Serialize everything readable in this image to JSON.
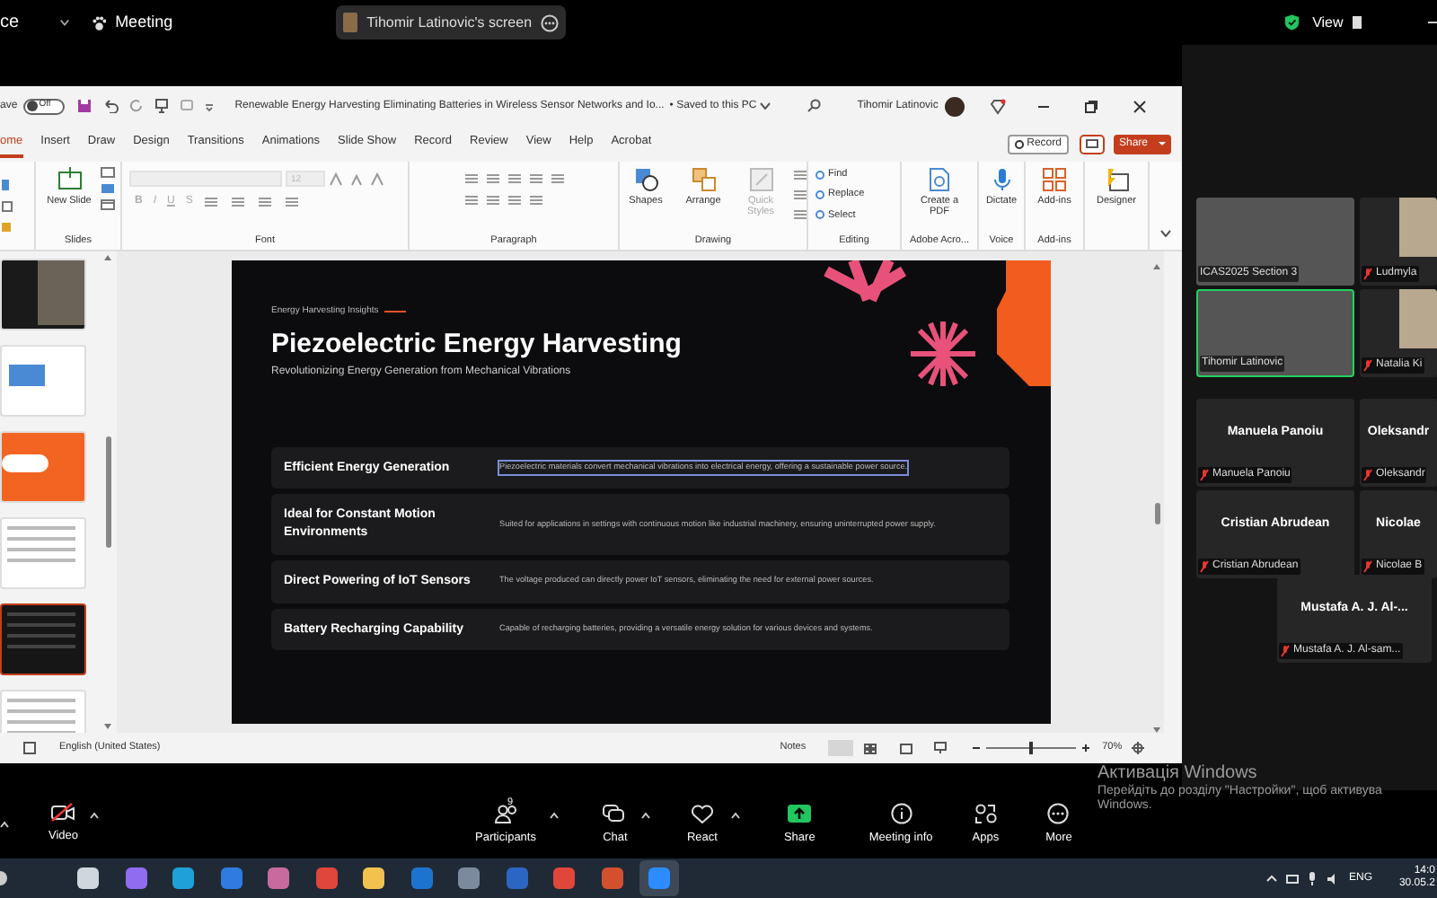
{
  "meeting_bar": {
    "app_name": "ce",
    "menu": "Meeting",
    "shared_screen": "Tihomir Latinovic's screen",
    "view": "View"
  },
  "powerpoint": {
    "autosave": {
      "label": "ave",
      "state": "Off",
      "on": false
    },
    "document_title": "Renewable Energy Harvesting Eliminating Batteries in Wireless Sensor Networks and Io...",
    "save_status": "• Saved to this PC",
    "user": "Tihomir Latinovic",
    "tabs": [
      {
        "label": "ome",
        "selected": true
      },
      {
        "label": "Insert",
        "selected": false
      },
      {
        "label": "Draw",
        "selected": false
      },
      {
        "label": "Design",
        "selected": false
      },
      {
        "label": "Transitions",
        "selected": false
      },
      {
        "label": "Animations",
        "selected": false
      },
      {
        "label": "Slide Show",
        "selected": false
      },
      {
        "label": "Record",
        "selected": false
      },
      {
        "label": "Review",
        "selected": false
      },
      {
        "label": "View",
        "selected": false
      },
      {
        "label": "Help",
        "selected": false
      },
      {
        "label": "Acrobat",
        "selected": false
      }
    ],
    "record_button": "Record",
    "share_button": "Share",
    "ribbon": {
      "font_size": "12",
      "font_styles": [
        "B",
        "I",
        "U",
        "S"
      ],
      "groups": [
        {
          "kind": "slides",
          "label": "Slides",
          "buttons": [
            {
              "label": "New Slide",
              "disabled": false
            }
          ]
        },
        {
          "kind": "font",
          "label": "Font"
        },
        {
          "kind": "paragraph",
          "label": "Paragraph"
        },
        {
          "kind": "drawing",
          "label": "Drawing",
          "buttons": [
            {
              "label": "Shapes",
              "disabled": false
            },
            {
              "label": "Arrange",
              "disabled": false
            },
            {
              "label": "Quick Styles",
              "disabled": true
            }
          ]
        },
        {
          "kind": "editing",
          "label": "Editing",
          "buttons": [
            {
              "label": "Find",
              "disabled": false
            },
            {
              "label": "Replace",
              "disabled": false
            },
            {
              "label": "Select",
              "disabled": false
            }
          ]
        },
        {
          "kind": "acrobat",
          "label": "Adobe Acro...",
          "buttons": [
            {
              "label": "Create a PDF",
              "disabled": false
            }
          ]
        },
        {
          "kind": "voice",
          "label": "Voice",
          "buttons": [
            {
              "label": "Dictate",
              "disabled": false
            }
          ]
        },
        {
          "kind": "addins",
          "label": "Add-ins",
          "buttons": [
            {
              "label": "Add-ins",
              "disabled": false
            }
          ]
        },
        {
          "kind": "designer",
          "buttons": [
            {
              "label": "Designer",
              "disabled": false
            }
          ]
        }
      ]
    },
    "thumbnails": [
      {
        "kind": "photo",
        "selected": false
      },
      {
        "kind": "diagram",
        "selected": false
      },
      {
        "kind": "orange",
        "selected": false
      },
      {
        "kind": "text",
        "selected": false
      },
      {
        "kind": "dark",
        "selected": true
      },
      {
        "kind": "text",
        "selected": false
      }
    ],
    "slide": {
      "eyebrow": "Energy Harvesting Insights",
      "title": "Piezoelectric Energy Harvesting",
      "subtitle": "Revolutionizing Energy Generation from Mechanical Vibrations",
      "rows": [
        {
          "heading": "Efficient Energy Generation",
          "text": "Piezoelectric materials convert mechanical vibrations into electrical energy, offering a sustainable power source.",
          "selected": true
        },
        {
          "heading": "Ideal for Constant Motion Environments",
          "text": "Suited for applications in settings with continuous motion like industrial machinery, ensuring uninterrupted power supply.",
          "selected": false
        },
        {
          "heading": "Direct Powering of IoT Sensors",
          "text": "The voltage produced can directly power IoT sensors, eliminating the need for external power sources.",
          "selected": false
        },
        {
          "heading": "Battery Recharging Capability",
          "text": "Capable of recharging batteries, providing a versatile energy solution for various devices and systems.",
          "selected": false
        }
      ]
    },
    "status_bar": {
      "language": "English (United States)",
      "notes": "Notes",
      "zoom": "70%",
      "zoom_slider": {
        "level": 0.5
      }
    }
  },
  "gallery": [
    {
      "kind": "video",
      "label": "ICAS2025 Section 3",
      "muted": false,
      "speaking": false
    },
    {
      "kind": "video",
      "label": "Ludmyla",
      "muted": true,
      "speaking": false
    },
    {
      "kind": "video",
      "label": "Tihomir Latinovic",
      "muted": false,
      "speaking": true
    },
    {
      "kind": "video",
      "label": "Natalia Ki",
      "muted": true,
      "speaking": false
    },
    {
      "kind": "name",
      "name": "Manuela Panoiu",
      "label": "Manuela Panoiu",
      "muted": true,
      "speaking": false
    },
    {
      "kind": "name",
      "name": "Oleksandr",
      "label": "Oleksandr",
      "muted": true,
      "speaking": false
    },
    {
      "kind": "name",
      "name": "Cristian Abrudean",
      "label": "Cristian Abrudean",
      "muted": true,
      "speaking": false
    },
    {
      "kind": "name",
      "name": "Nicolae",
      "label": "Nicolae B",
      "muted": true,
      "speaking": false
    },
    {
      "kind": "name",
      "name": "Mustafa A. J. Al-...",
      "label": "Mustafa A. J. Al-sam...",
      "muted": true,
      "speaking": false
    }
  ],
  "toolbar": {
    "video": {
      "label": "Video",
      "off": true
    },
    "items": [
      {
        "kind": "participants",
        "label": "Participants",
        "count": "9",
        "menu": true
      },
      {
        "kind": "chat",
        "label": "Chat",
        "menu": true
      },
      {
        "kind": "react",
        "label": "React",
        "menu": true
      },
      {
        "kind": "share",
        "label": "Share",
        "menu": false
      },
      {
        "kind": "info",
        "label": "Meeting info",
        "menu": false
      },
      {
        "kind": "apps",
        "label": "Apps",
        "menu": false
      },
      {
        "kind": "more",
        "label": "More",
        "menu": false
      }
    ]
  },
  "windows_activation": {
    "title": "Активація Windows",
    "line_1": "Перейдіть до розділу \"Настройки\", щоб активува",
    "line_2": "Windows."
  },
  "taskbar": {
    "apps": [
      {
        "kind": "taskview",
        "active": false
      },
      {
        "kind": "copilot",
        "active": false
      },
      {
        "kind": "edge",
        "active": false
      },
      {
        "kind": "store",
        "active": false
      },
      {
        "kind": "disk",
        "active": false
      },
      {
        "kind": "chrome",
        "active": false
      },
      {
        "kind": "folder",
        "active": false
      },
      {
        "kind": "outlook",
        "active": false
      },
      {
        "kind": "calculator",
        "active": false
      },
      {
        "kind": "word",
        "active": false
      },
      {
        "kind": "chrome",
        "active": false
      },
      {
        "kind": "powerpoint",
        "active": false
      },
      {
        "kind": "zoom",
        "active": true
      }
    ],
    "language": "ENG",
    "time": "14:0",
    "date": "30.05.2"
  }
}
